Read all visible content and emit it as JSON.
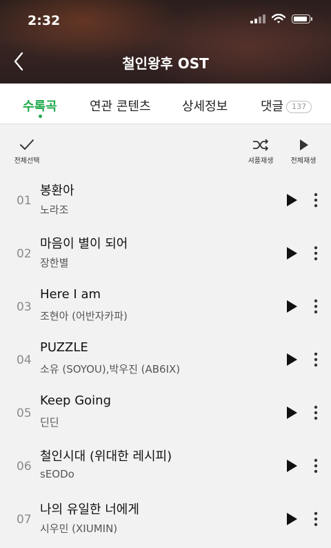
{
  "status_bar": {
    "time": "2:32"
  },
  "header": {
    "title": "철인왕후 OST"
  },
  "tabs": [
    {
      "label": "수록곡"
    },
    {
      "label": "연관 콘텐츠"
    },
    {
      "label": "상세정보"
    },
    {
      "label": "댓글",
      "count": "137"
    }
  ],
  "toolbar": {
    "select_all": "전체선택",
    "shuffle_play": "셔플재생",
    "play_all": "전체재생"
  },
  "tracks": [
    {
      "number": "01",
      "title": "봉환아",
      "artist": "노라조"
    },
    {
      "number": "02",
      "title": "마음이 별이 되어",
      "artist": "장한별"
    },
    {
      "number": "03",
      "title": "Here I am",
      "artist": "조현아 (어반자카파)"
    },
    {
      "number": "04",
      "title": "PUZZLE",
      "artist": "소유 (SOYOU),박우진 (AB6IX)"
    },
    {
      "number": "05",
      "title": "Keep Going",
      "artist": "딘딘"
    },
    {
      "number": "06",
      "title": "철인시대 (위대한 레시피)",
      "artist": "sEODo"
    },
    {
      "number": "07",
      "title": "나의 유일한 너에게",
      "artist": "시우민 (XIUMIN)"
    }
  ],
  "colors": {
    "accent": "#1ea84a",
    "background": "#f2f2f2"
  },
  "icons": [
    "back-arrow-icon",
    "check-icon",
    "shuffle-icon",
    "play-icon",
    "more-vertical-icon"
  ]
}
